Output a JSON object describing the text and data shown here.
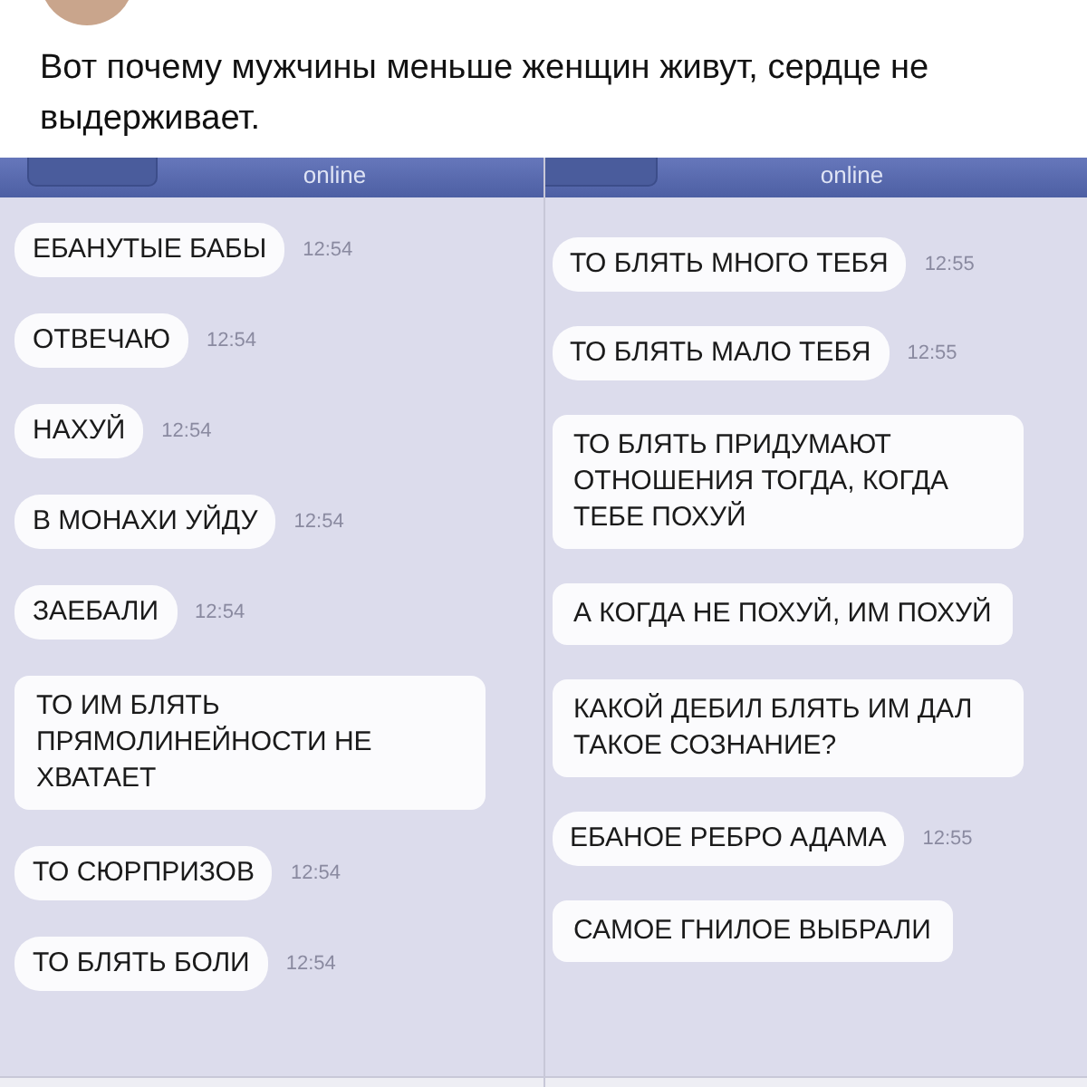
{
  "post": {
    "text": "Вот почему мужчины меньше женщин живут, сердце не выдерживает."
  },
  "chat_panels": [
    {
      "status": "online",
      "messages": [
        {
          "text": "ЕБАНУТЫЕ БАБЫ",
          "time": "12:54"
        },
        {
          "text": "ОТВЕЧАЮ",
          "time": "12:54"
        },
        {
          "text": "НАХУЙ",
          "time": "12:54"
        },
        {
          "text": "В МОНАХИ УЙДУ",
          "time": "12:54"
        },
        {
          "text": "ЗАЕБАЛИ",
          "time": "12:54"
        },
        {
          "text": "ТО ИМ БЛЯТЬ ПРЯМОЛИНЕЙНОСТИ НЕ ХВАТАЕТ"
        },
        {
          "text": "ТО СЮРПРИЗОВ",
          "time": "12:54"
        },
        {
          "text": "ТО БЛЯТЬ БОЛИ",
          "time": "12:54"
        }
      ]
    },
    {
      "status": "online",
      "messages": [
        {
          "text": "ТО БЛЯТЬ МНОГО ТЕБЯ",
          "time": "12:55"
        },
        {
          "text": "ТО БЛЯТЬ МАЛО ТЕБЯ",
          "time": "12:55"
        },
        {
          "text": "ТО БЛЯТЬ ПРИДУМАЮТ ОТНОШЕНИЯ ТОГДА, КОГДА ТЕБЕ ПОХУЙ"
        },
        {
          "text": "А КОГДА НЕ ПОХУЙ, ИМ ПОХУЙ"
        },
        {
          "text": "КАКОЙ ДЕБИЛ БЛЯТЬ ИМ ДАЛ ТАКОЕ СОЗНАНИЕ?"
        },
        {
          "text": "ЕБАНОЕ РЕБРО АДАМА",
          "time": "12:55"
        },
        {
          "text": "САМОЕ ГНИЛОЕ ВЫБРАЛИ"
        }
      ]
    }
  ]
}
